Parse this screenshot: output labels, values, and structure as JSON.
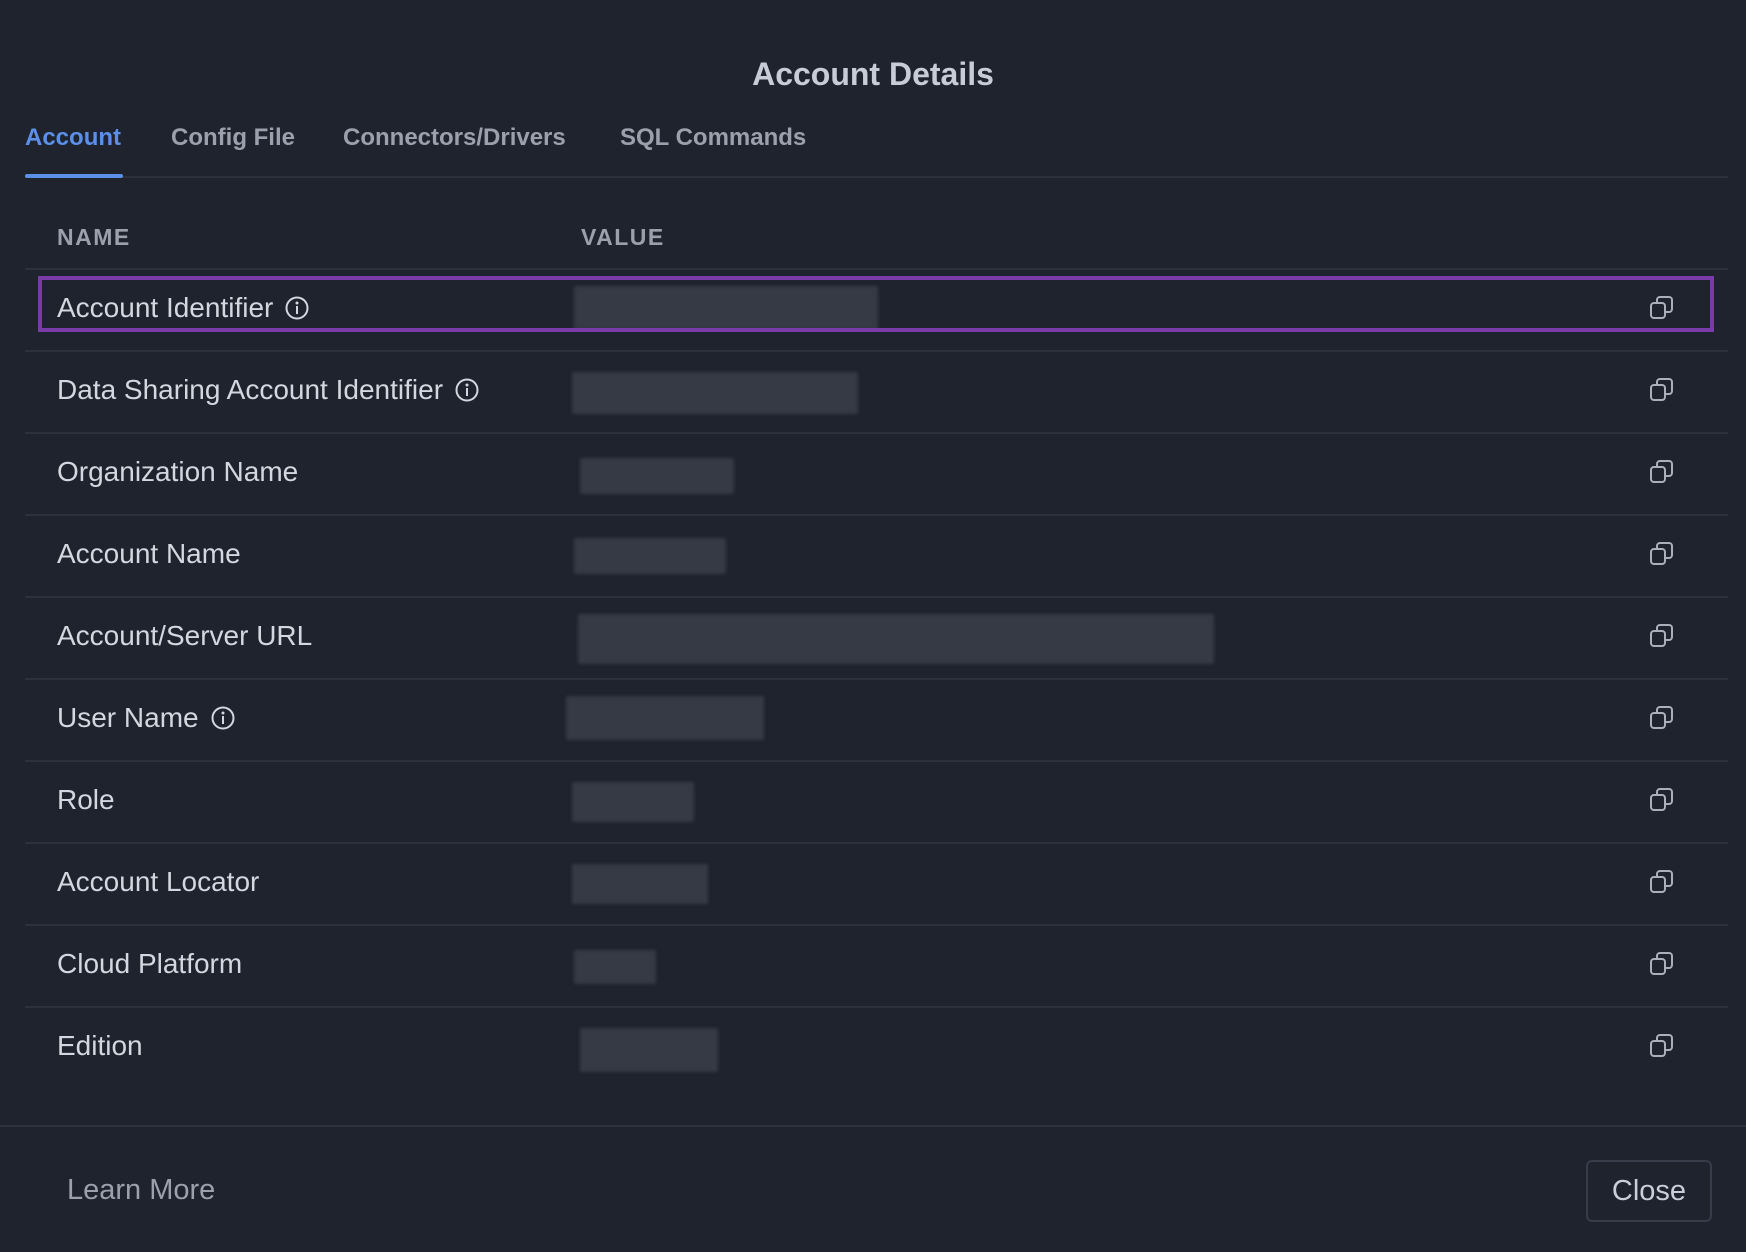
{
  "dialog": {
    "title": "Account Details"
  },
  "tabs": [
    {
      "label": "Account",
      "active": true
    },
    {
      "label": "Config File",
      "active": false
    },
    {
      "label": "Connectors/Drivers",
      "active": false
    },
    {
      "label": "SQL Commands",
      "active": false
    }
  ],
  "table": {
    "columns": {
      "name": "NAME",
      "value": "VALUE"
    },
    "rows": [
      {
        "name": "Account Identifier",
        "has_info_icon": true,
        "value_redacted": true,
        "highlighted": true
      },
      {
        "name": "Data Sharing Account Identifier",
        "has_info_icon": true,
        "value_redacted": true
      },
      {
        "name": "Organization Name",
        "has_info_icon": false,
        "value_redacted": true
      },
      {
        "name": "Account Name",
        "has_info_icon": false,
        "value_redacted": true
      },
      {
        "name": "Account/Server URL",
        "has_info_icon": false,
        "value_redacted": true
      },
      {
        "name": "User Name",
        "has_info_icon": true,
        "value_redacted": true
      },
      {
        "name": "Role",
        "has_info_icon": false,
        "value_redacted": true
      },
      {
        "name": "Account Locator",
        "has_info_icon": false,
        "value_redacted": true
      },
      {
        "name": "Cloud Platform",
        "has_info_icon": false,
        "value_redacted": true
      },
      {
        "name": "Edition",
        "has_info_icon": false,
        "value_redacted": true
      }
    ]
  },
  "footer": {
    "learn_more_label": "Learn More",
    "close_label": "Close"
  },
  "icons": {
    "info": "info-icon",
    "copy": "copy-icon"
  },
  "colors": {
    "background": "#1e232e",
    "accent": "#5b8fe8",
    "highlight_border": "#7a3aa8",
    "divider": "#2b313d"
  }
}
